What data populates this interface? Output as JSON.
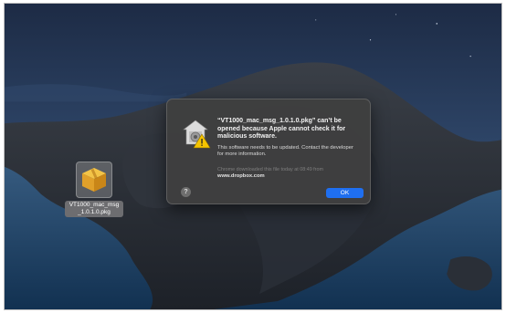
{
  "desktop": {
    "file_name": "VT1000_mac_msg_1.0.1.0.pkg",
    "file_icon": "package-icon"
  },
  "dialog": {
    "icon": "gatekeeper-warning-icon",
    "title": "“VT1000_mac_msg_1.0.1.0.pkg” can’t be opened because Apple cannot check it for malicious software.",
    "body": "This software needs to be updated. Contact the developer for more information.",
    "download_info": "Chrome downloaded this file today at 08:49 from",
    "download_source": "www.dropbox.com",
    "help_label": "?",
    "ok_label": "OK"
  },
  "colors": {
    "accent": "#1f6ff0",
    "dialog_bg": "#404040"
  }
}
